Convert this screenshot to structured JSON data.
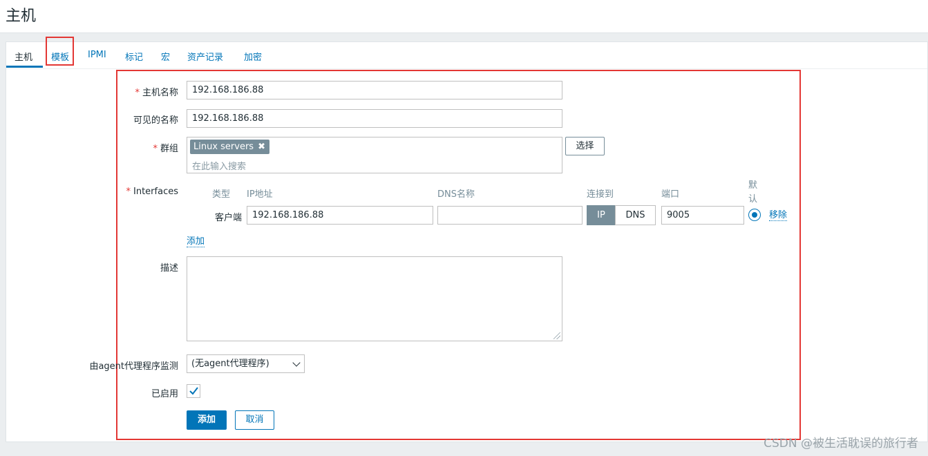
{
  "page": {
    "title": "主机"
  },
  "tabs": [
    {
      "label": "主机"
    },
    {
      "label": "模板"
    },
    {
      "label": "IPMI"
    },
    {
      "label": "标记"
    },
    {
      "label": "宏"
    },
    {
      "label": "资产记录"
    },
    {
      "label": "加密"
    }
  ],
  "form": {
    "host_name": {
      "label": "主机名称",
      "value": "192.168.186.88"
    },
    "visible_name": {
      "label": "可见的名称",
      "value": "192.168.186.88"
    },
    "groups": {
      "label": "群组",
      "chips": [
        "Linux servers"
      ],
      "placeholder": "在此输入搜索",
      "select_button": "选择"
    },
    "interfaces": {
      "label": "Interfaces",
      "headers": {
        "type": "类型",
        "ip": "IP地址",
        "dns": "DNS名称",
        "connect": "连接到",
        "port": "端口",
        "default": "默认"
      },
      "rows": [
        {
          "type": "客户端",
          "ip": "192.168.186.88",
          "dns": "",
          "connect_ip": "IP",
          "connect_dns": "DNS",
          "connect_selected": "IP",
          "port": "9005",
          "remove": "移除"
        }
      ],
      "add_link": "添加"
    },
    "description": {
      "label": "描述",
      "value": ""
    },
    "monitored_by": {
      "label": "由agent代理程序监测",
      "value": "(无agent代理程序)"
    },
    "enabled": {
      "label": "已启用",
      "checked": true
    },
    "buttons": {
      "add": "添加",
      "cancel": "取消"
    }
  },
  "watermark": "CSDN @被生活耽误的旅行者",
  "colors": {
    "accent": "#0275b8",
    "highlight": "#e33734",
    "chip": "#768d99"
  }
}
